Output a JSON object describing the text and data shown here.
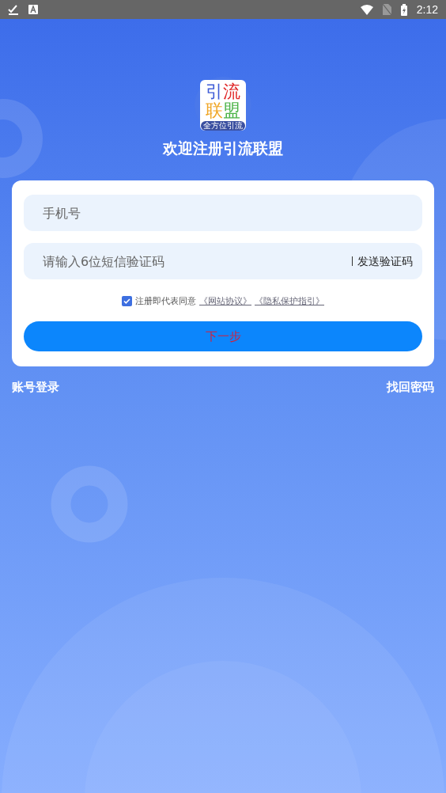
{
  "status_bar": {
    "time": "2:12"
  },
  "logo": {
    "characters": [
      {
        "text": "引",
        "color": "#3d5bd6"
      },
      {
        "text": "流",
        "color": "#e02a2a"
      },
      {
        "text": "联",
        "color": "#f0a626"
      },
      {
        "text": "盟",
        "color": "#4cb348"
      }
    ],
    "tagline": "全方位引流"
  },
  "title": "欢迎注册引流联盟",
  "form": {
    "phone": {
      "placeholder": "手机号"
    },
    "code": {
      "placeholder": "请输入6位短信验证码"
    },
    "send_code": "发送验证码",
    "agreement": {
      "checked": true,
      "text": "注册即代表同意",
      "links": [
        "《网站协议》",
        "《隐私保护指引》"
      ]
    },
    "submit": "下一步"
  },
  "footer": {
    "left": "账号登录",
    "right": "找回密码"
  }
}
